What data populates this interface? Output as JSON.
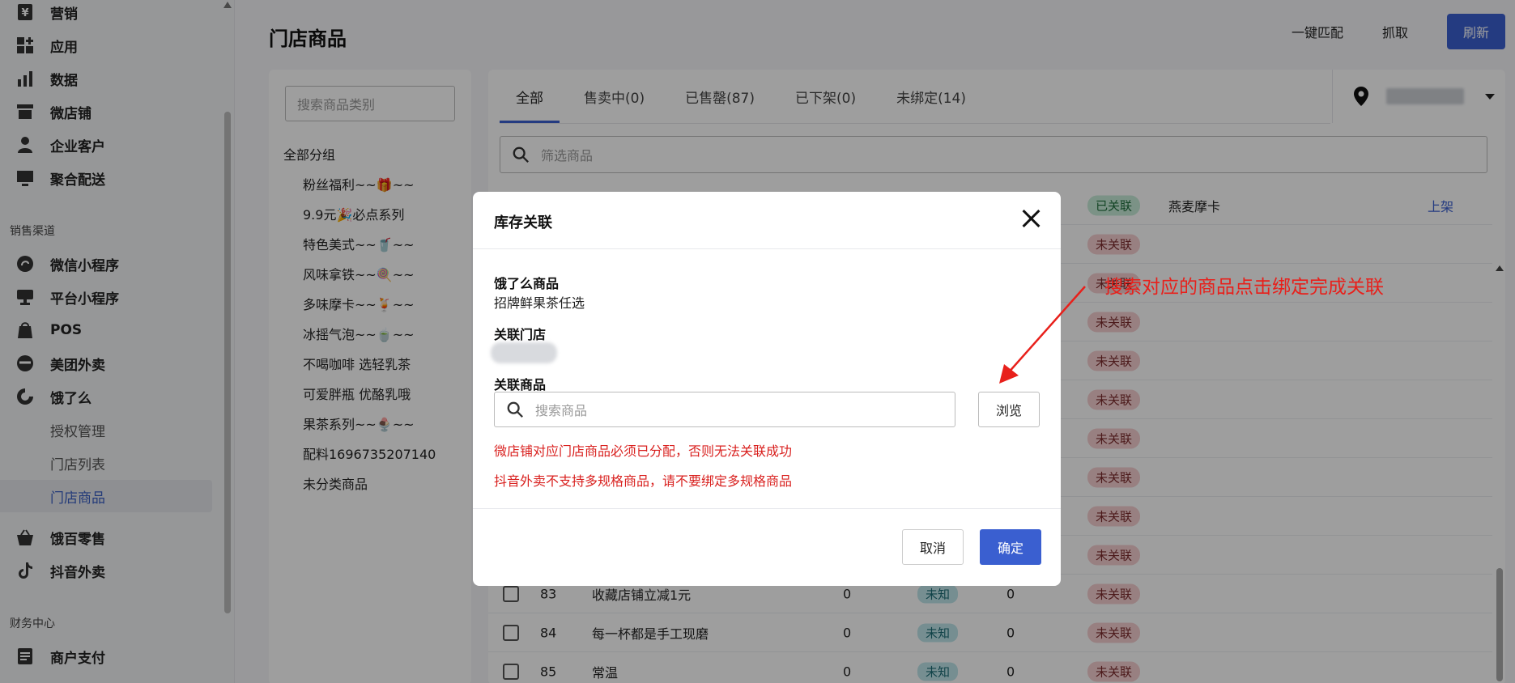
{
  "sidebar": {
    "items": [
      {
        "label": "营销",
        "icon": "yen-icon"
      },
      {
        "label": "应用",
        "icon": "apps-icon"
      },
      {
        "label": "数据",
        "icon": "bar-chart-icon"
      },
      {
        "label": "微店铺",
        "icon": "shop-icon"
      },
      {
        "label": "企业客户",
        "icon": "user-icon"
      },
      {
        "label": "聚合配送",
        "icon": "monitor-icon"
      }
    ],
    "group_sales": "销售渠道",
    "sales_items": [
      {
        "label": "微信小程序",
        "icon": "miniprogram-icon"
      },
      {
        "label": "平台小程序",
        "icon": "store-icon"
      },
      {
        "label": "POS",
        "icon": "bag-icon"
      },
      {
        "label": "美团外卖",
        "icon": "meituan-icon"
      },
      {
        "label": "饿了么",
        "icon": "eleme-icon"
      }
    ],
    "eleme_sub": [
      "授权管理",
      "门店列表",
      "门店商品"
    ],
    "sales_items_2": [
      {
        "label": "饿百零售",
        "icon": "basket-icon"
      },
      {
        "label": "抖音外卖",
        "icon": "tiktok-icon"
      }
    ],
    "group_finance": "财务中心",
    "finance_items": [
      {
        "label": "商户支付",
        "icon": "document-icon"
      }
    ]
  },
  "header": {
    "title": "门店商品",
    "match_label": "一键匹配",
    "fetch_label": "抓取",
    "refresh_label": "刷新"
  },
  "categories": {
    "search_placeholder": "搜索商品类别",
    "all_label": "全部分组",
    "items": [
      "粉丝福利~~🎁~~",
      "9.9元🎉必点系列",
      "特色美式~~🥤~~",
      "风味拿铁~~🍭~~",
      "多味摩卡~~🍹~~",
      "冰摇气泡~~🍵~~",
      "不喝咖啡 选轻乳茶",
      "可爱胖瓶 优酪乳哦",
      "果茶系列~~🍨~~",
      "配料1696735207140",
      "未分类商品"
    ]
  },
  "tabs": [
    "全部",
    "售卖中(0)",
    "已售罄(87)",
    "已下架(0)",
    "未绑定(14)"
  ],
  "filter_placeholder": "筛选商品",
  "table": {
    "first_row": {
      "status": "已关联",
      "linked_name": "燕麦摩卡",
      "action": "上架"
    },
    "unbound_label": "未关联",
    "rows": [
      {
        "id": "83",
        "name": "收藏店铺立减1元",
        "n1": "0",
        "tag": "未知",
        "n2": "0"
      },
      {
        "id": "84",
        "name": "每一杯都是手工现磨",
        "n1": "0",
        "tag": "未知",
        "n2": "0"
      },
      {
        "id": "85",
        "name": "常温",
        "n1": "0",
        "tag": "未知",
        "n2": "0"
      }
    ]
  },
  "modal": {
    "title": "库存关联",
    "eleme_product_label": "饿了么商品",
    "eleme_product_value": "招牌鲜果茶任选",
    "store_label": "关联门店",
    "linked_product_label": "关联商品",
    "search_placeholder": "搜索商品",
    "browse_label": "浏览",
    "warnings": [
      "微店铺对应门店商品必须已分配，否则无法关联成功",
      "抖音外卖不支持多规格商品，请不要绑定多规格商品"
    ],
    "cancel_label": "取消",
    "ok_label": "确定"
  },
  "annotation": "搜索对应的商品点击绑定完成关联",
  "colors": {
    "accent": "#3a5fd0",
    "warn": "#d9211f",
    "annotation": "#e8201b"
  }
}
